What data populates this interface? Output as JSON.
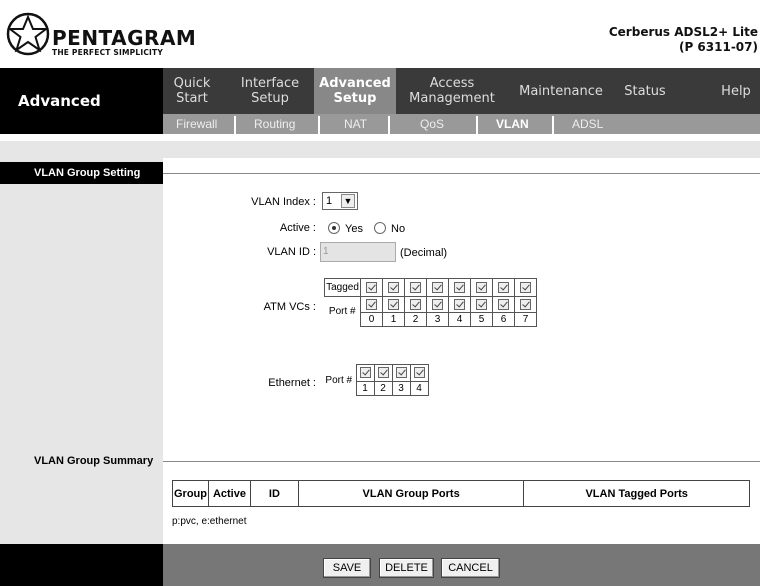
{
  "brand": {
    "name": "PENTAGRAM",
    "tagline": "THE PERFECT SIMPLICITY"
  },
  "product": {
    "line1": "Cerberus ADSL2+ Lite",
    "line2": "(P 6311-07)"
  },
  "section": "Advanced",
  "tabs": [
    {
      "label": "Quick Start",
      "l1": "Quick",
      "l2": "Start"
    },
    {
      "label": "Interface Setup",
      "l1": "Interface",
      "l2": "Setup"
    },
    {
      "label": "Advanced Setup",
      "l1": "Advanced",
      "l2": "Setup",
      "active": true
    },
    {
      "label": "Access Management",
      "l1": "Access",
      "l2": "Management"
    },
    {
      "label": "Maintenance",
      "l1": "Maintenance",
      "l2": ""
    },
    {
      "label": "Status",
      "l1": "Status",
      "l2": ""
    },
    {
      "label": "Help",
      "l1": "Help",
      "l2": ""
    }
  ],
  "subtabs": [
    "Firewall",
    "Routing",
    "NAT",
    "QoS",
    "VLAN",
    "ADSL"
  ],
  "active_subtab": "VLAN",
  "group_setting": {
    "title": "VLAN Group Setting",
    "vlan_index_label": "VLAN Index :",
    "vlan_index_value": "1",
    "active_label": "Active :",
    "yes_label": "Yes",
    "no_label": "No",
    "active_value": "Yes",
    "vlan_id_label": "VLAN ID :",
    "vlan_id_value": "1",
    "vlan_id_unit": "(Decimal)",
    "atm_label": "ATM VCs :",
    "tagged_label": "Tagged",
    "port_label": "Port #",
    "atm_ports": [
      "0",
      "1",
      "2",
      "3",
      "4",
      "5",
      "6",
      "7"
    ],
    "ethernet_label": "Ethernet :",
    "eth_ports": [
      "1",
      "2",
      "3",
      "4"
    ]
  },
  "group_summary": {
    "title": "VLAN Group Summary",
    "columns": [
      "Group",
      "Active",
      "ID",
      "VLAN Group Ports",
      "VLAN Tagged Ports"
    ],
    "note": "p:pvc, e:ethernet"
  },
  "buttons": {
    "save": "SAVE",
    "delete": "DELETE",
    "cancel": "CANCEL"
  }
}
